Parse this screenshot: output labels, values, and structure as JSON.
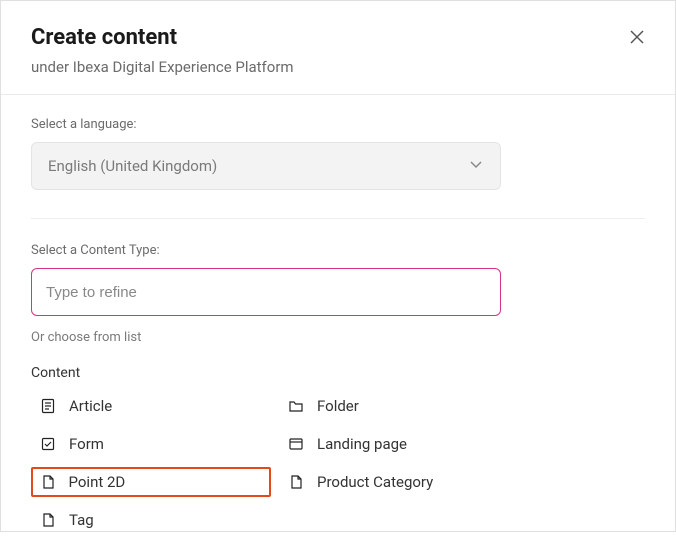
{
  "header": {
    "title": "Create content",
    "subtitle": "under Ibexa Digital Experience Platform"
  },
  "language": {
    "label": "Select a language:",
    "value": "English (United Kingdom)"
  },
  "contentType": {
    "label": "Select a Content Type:",
    "placeholder": "Type to refine",
    "chooseLabel": "Or choose from list",
    "groupLabel": "Content",
    "items": {
      "article": "Article",
      "folder": "Folder",
      "form": "Form",
      "landingPage": "Landing page",
      "point2d": "Point 2D",
      "productCategory": "Product Category",
      "tag": "Tag"
    }
  }
}
